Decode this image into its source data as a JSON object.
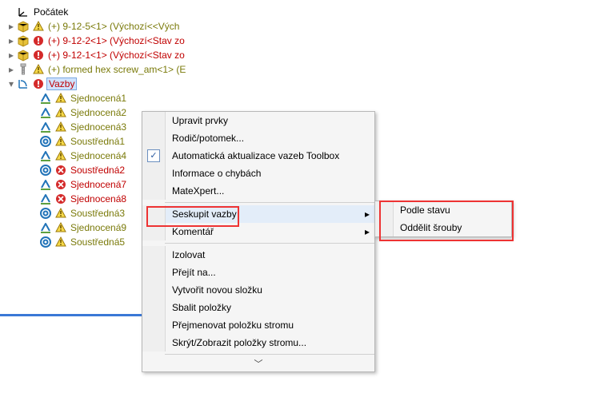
{
  "tree": {
    "origin": "Počátek",
    "items": [
      "(+) 9-12-5<1> (Výchozí<<Vých",
      "(+) 9-12-2<1> (Výchozí<Stav zo",
      "(+) 9-12-1<1> (Výchozí<Stav zo",
      "(+) formed hex screw_am<1> (E"
    ],
    "mates_label": "Vazby",
    "mates": [
      {
        "label": "Sjednocená1",
        "color": "olive",
        "icon": "coincident",
        "badge": "warn"
      },
      {
        "label": "Sjednocená2",
        "color": "olive",
        "icon": "coincident",
        "badge": "warn"
      },
      {
        "label": "Sjednocená3",
        "color": "olive",
        "icon": "coincident",
        "badge": "warn"
      },
      {
        "label": "Soustředná1",
        "color": "olive",
        "icon": "concentric",
        "badge": "warn"
      },
      {
        "label": "Sjednocená4",
        "color": "olive",
        "icon": "coincident",
        "badge": "warn"
      },
      {
        "label": "Soustředná2",
        "color": "red",
        "icon": "concentric",
        "badge": "error"
      },
      {
        "label": "Sjednocená7",
        "color": "red",
        "icon": "coincident",
        "badge": "error"
      },
      {
        "label": "Sjednocená8",
        "color": "red",
        "icon": "coincident",
        "badge": "error"
      },
      {
        "label": "Soustředná3",
        "color": "olive",
        "icon": "concentric",
        "badge": "warn"
      },
      {
        "label": "Sjednocená9",
        "color": "olive",
        "icon": "coincident",
        "badge": "warn"
      },
      {
        "label": "Soustředná5",
        "color": "olive",
        "icon": "concentric",
        "badge": "warn"
      }
    ]
  },
  "menu": {
    "items": [
      {
        "label": "Upravit prvky"
      },
      {
        "label": "Rodič/potomek..."
      },
      {
        "label": "Automatická aktualizace vazeb Toolbox",
        "check": true
      },
      {
        "label": "Informace o chybách"
      },
      {
        "label": "MateXpert..."
      },
      {
        "label": "Seskupit vazby",
        "sub": true,
        "hover": true,
        "sep_before": true
      },
      {
        "label": "Komentář",
        "sub": true
      },
      {
        "label": "Izolovat",
        "sep_before": true
      },
      {
        "label": "Přejít na..."
      },
      {
        "label": "Vytvořit novou složku"
      },
      {
        "label": "Sbalit položky"
      },
      {
        "label": "Přejmenovat položku stromu"
      },
      {
        "label": "Skrýt/Zobrazit položky stromu..."
      }
    ]
  },
  "submenu": {
    "items": [
      {
        "label": "Podle stavu"
      },
      {
        "label": "Oddělit šrouby"
      }
    ]
  },
  "glyphs": {
    "chevron_down": "⌄",
    "sub": "▸"
  }
}
